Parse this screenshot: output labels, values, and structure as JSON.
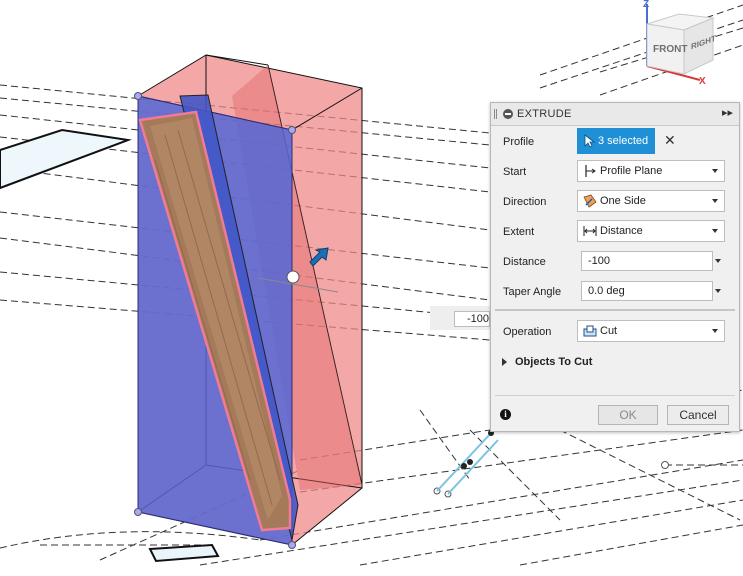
{
  "viewcube": {
    "front_label": "FRONT",
    "right_label": "RIGHT",
    "axis_z": "Z",
    "axis_x": "X"
  },
  "canvas": {
    "distance_input_value": "-100"
  },
  "dialog": {
    "title": "EXTRUDE",
    "expand_glyph": "▸▸",
    "profile_label": "Profile",
    "profile_value": "3 selected",
    "clear_glyph": "✕",
    "start_label": "Start",
    "start_value": "Profile Plane",
    "direction_label": "Direction",
    "direction_value": "One Side",
    "extent_label": "Extent",
    "extent_value": "Distance",
    "distance_label": "Distance",
    "distance_value": "-100",
    "taper_label": "Taper Angle",
    "taper_value": "0.0 deg",
    "operation_label": "Operation",
    "operation_value": "Cut",
    "objects_to_cut_label": "Objects To Cut",
    "info_glyph": "i",
    "ok_label": "OK",
    "cancel_label": "Cancel"
  },
  "colors": {
    "selection_blue": "#1f8fd6",
    "cut_body_red": "#f08585",
    "profile_body_blue": "#5466d6",
    "wood_brown": "#a47a5b"
  }
}
